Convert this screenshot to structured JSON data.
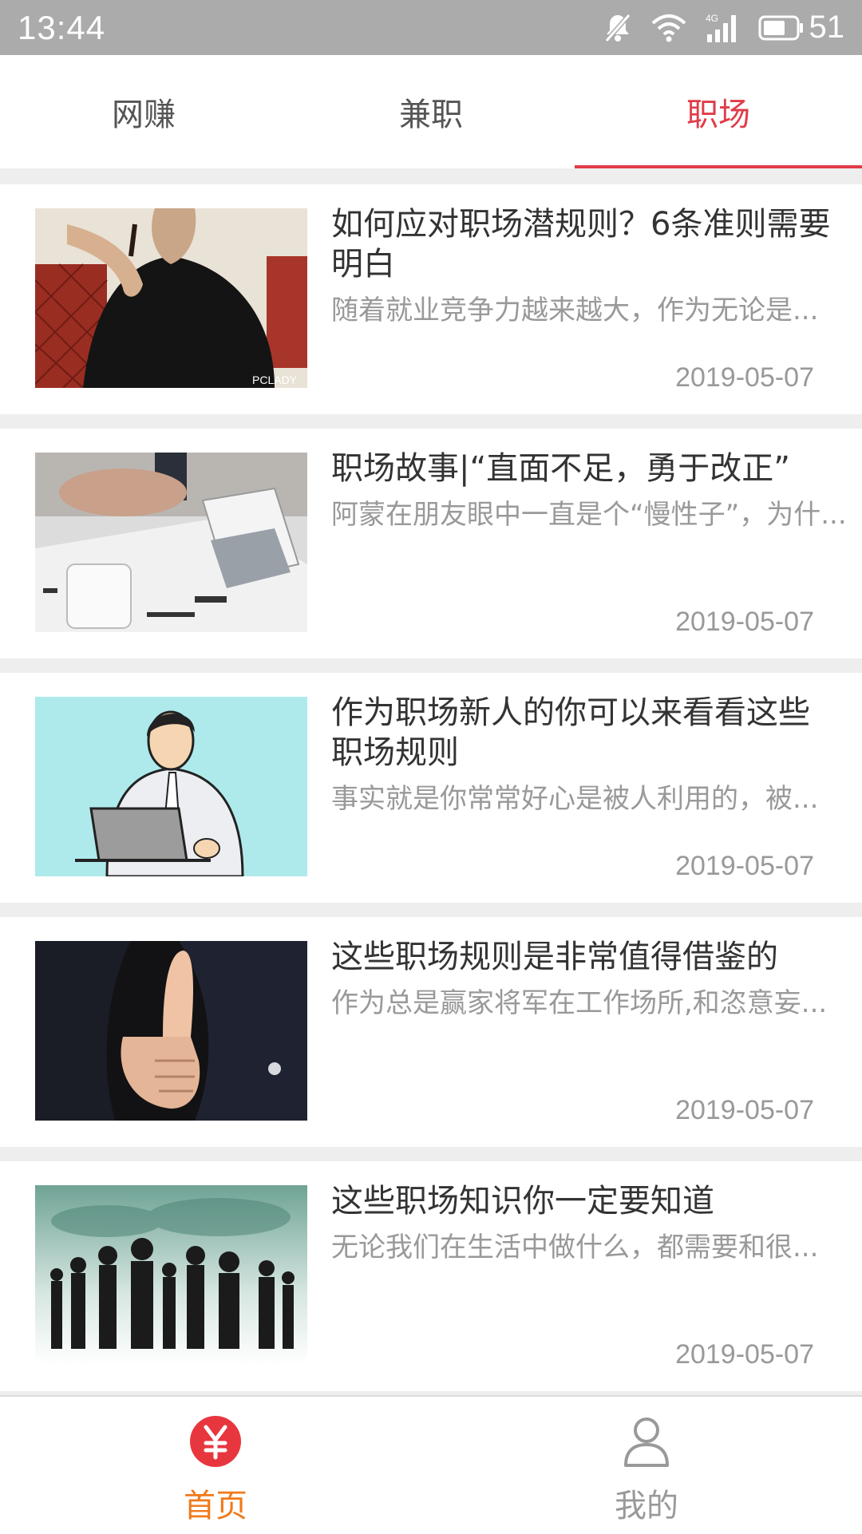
{
  "status_bar": {
    "time": "13:44",
    "battery": "51"
  },
  "tabs": [
    {
      "label": "网赚",
      "active": false
    },
    {
      "label": "兼职",
      "active": false
    },
    {
      "label": "职场",
      "active": true
    }
  ],
  "articles": [
    {
      "title": "如何应对职场潜规则？6条准则需要明白",
      "summary": "随着就业竞争力越来越大，作为无论是...",
      "date": "2019-05-07",
      "thumb_watermark": "PCLADY"
    },
    {
      "title": "职场故事|“直面不足，勇于改正”",
      "summary": "阿蒙在朋友眼中一直是个“慢性子”，为什...",
      "date": "2019-05-07"
    },
    {
      "title": "作为职场新人的你可以来看看这些职场规则",
      "summary": "事实就是你常常好心是被人利用的，被...",
      "date": "2019-05-07"
    },
    {
      "title": "这些职场规则是非常值得借鉴的",
      "summary": "作为总是赢家将军在工作场所,和恣意妄...",
      "date": "2019-05-07"
    },
    {
      "title": "这些职场知识你一定要知道",
      "summary": "无论我们在生活中做什么，都需要和很...",
      "date": "2019-05-07"
    }
  ],
  "bottom_nav": [
    {
      "label": "首页",
      "icon": "yen-icon",
      "active": true
    },
    {
      "label": "我的",
      "icon": "user-icon",
      "active": false
    }
  ],
  "colors": {
    "accent": "#e03c48",
    "nav_active": "#f07a1c",
    "status_bar": "#ababab"
  }
}
